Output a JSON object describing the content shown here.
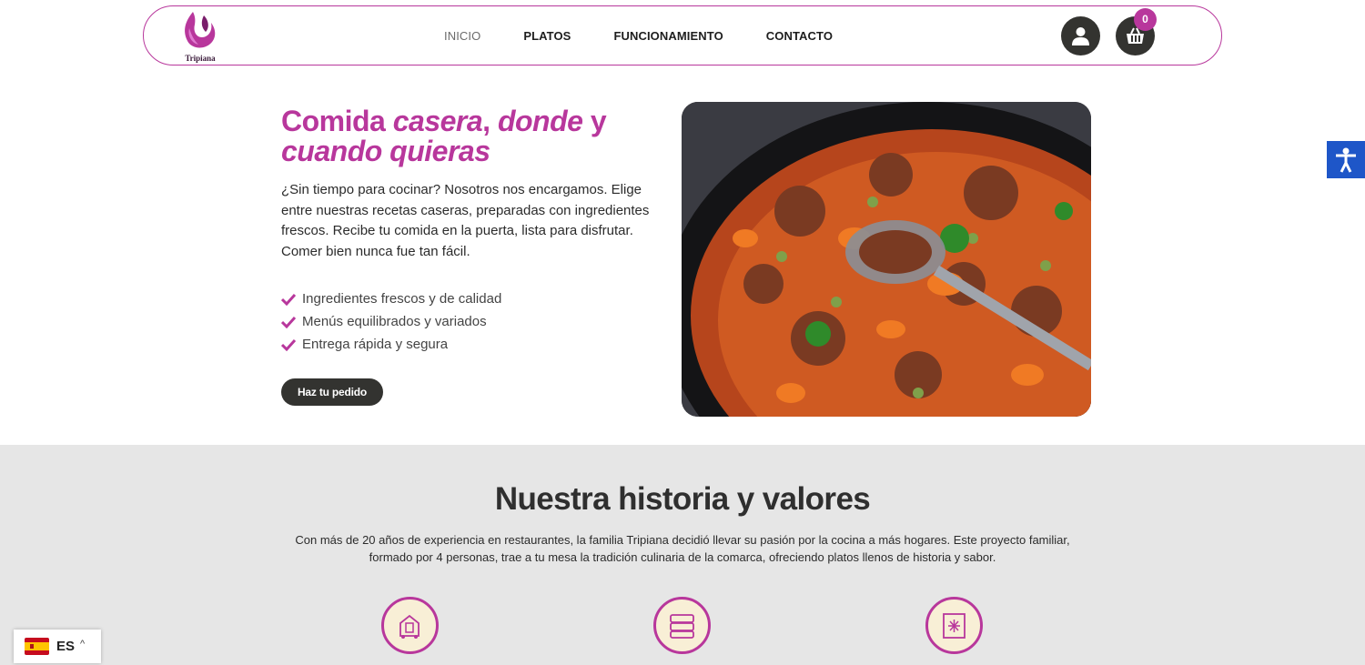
{
  "brand": {
    "logo_text": "Tripiana",
    "accent_color": "#b8379c",
    "dark_color": "#333330"
  },
  "nav": {
    "items": [
      {
        "label": "INICIO",
        "active": true
      },
      {
        "label": "PLATOS",
        "active": false
      },
      {
        "label": "FUNCIONAMIENTO",
        "active": false
      },
      {
        "label": "CONTACTO",
        "active": false
      }
    ]
  },
  "header": {
    "user_icon": "user-icon",
    "cart_icon": "basket-icon",
    "cart_count": "0"
  },
  "hero": {
    "title_part1": "Comida ",
    "title_part2": "casera",
    "title_part3": ", ",
    "title_part4": "donde",
    "title_part5": " y",
    "title_part6": "cuando",
    "title_part7": " ",
    "title_part8": "quieras",
    "description": "¿Sin tiempo para cocinar? Nosotros nos encargamos. Elige entre nuestras recetas caseras, preparadas con ingredientes frescos. Recibe tu comida en la puerta, lista para disfrutar. Comer bien nunca fue tan fácil.",
    "features": [
      "Ingredientes frescos y de calidad",
      "Menús equilibrados y variados",
      "Entrega rápida y segura"
    ],
    "cta_label": "Haz tu pedido",
    "image_icon": "stew-image"
  },
  "values": {
    "title": "Nuestra historia y valores",
    "text": "Con más de 20 años de experiencia en restaurantes, la familia Tripiana decidió llevar su pasión por la cocina a más hogares. Este proyecto familiar, formado por 4 personas, trae a tu mesa la tradición culinaria de la comarca, ofreciendo platos llenos de historia y sabor.",
    "icons": [
      "building-delivery-icon",
      "food-containers-icon",
      "freezer-icon"
    ]
  },
  "accessibility": {
    "icon": "accessibility-icon",
    "color": "#1e56c8"
  },
  "language": {
    "code": "ES",
    "flag": "spain-flag-icon"
  }
}
